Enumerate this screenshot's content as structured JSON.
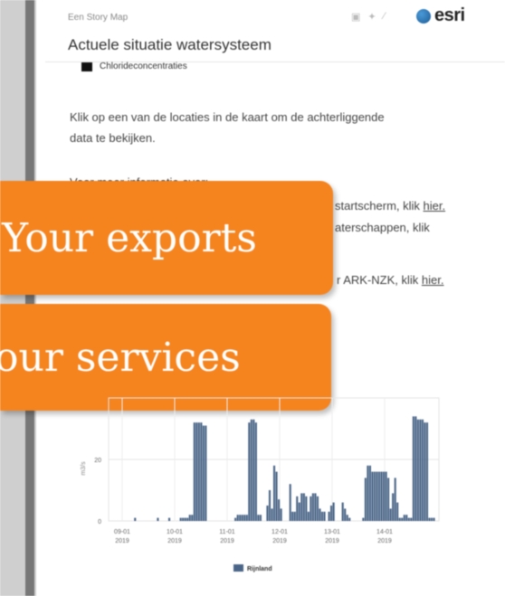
{
  "header": {
    "story_label": "Een Story Map",
    "title": "Actuele situatie watersysteem",
    "share_icons": [
      "facebook-icon",
      "twitter-icon",
      "link-icon"
    ],
    "logo_text": "esri"
  },
  "legend_top": {
    "label": "Chlorideconcentraties",
    "color": "#111111"
  },
  "content": {
    "intro_line1": "Klik op een van de locaties in de kaart om de achterliggende",
    "intro_line2": "data te bekijken.",
    "more_info": "Voor meer informatie over:",
    "line_a_text": "startscherm, klik ",
    "line_a_link": "hier.",
    "line_b_text": "aterschappen, klik",
    "line_c_text": "r ARK-NZK, klik ",
    "line_c_link": "hier."
  },
  "overlays": {
    "exports_label": "Your exports",
    "services_label": "our services",
    "color": "#f5841f"
  },
  "chart_data": {
    "type": "bar",
    "ylabel": "m3/s",
    "ylim": [
      0,
      40
    ],
    "yticks": [
      0,
      20
    ],
    "xtick_labels": [
      [
        "09-01",
        "2019"
      ],
      [
        "10-01",
        "2019"
      ],
      [
        "11-01",
        "2019"
      ],
      [
        "12-01",
        "2019"
      ],
      [
        "13-01",
        "2019"
      ],
      [
        "14-01",
        "2019"
      ]
    ],
    "legend": "Rijnland",
    "bar_color": "#4a6587",
    "values": [
      0,
      0,
      0,
      0,
      0,
      0,
      0,
      0,
      1,
      0,
      0,
      0,
      0,
      0,
      0,
      0,
      0,
      0,
      1,
      0,
      0,
      0,
      0,
      1,
      0,
      0,
      0,
      0,
      1,
      1,
      1,
      1,
      2,
      2,
      32,
      32,
      32,
      32,
      31,
      31,
      0,
      0,
      0,
      0,
      0,
      0,
      0,
      0,
      0,
      0,
      0,
      0,
      1,
      2,
      2,
      2,
      2,
      2,
      32,
      33,
      33,
      32,
      2,
      2,
      0,
      0,
      5,
      10,
      4,
      18,
      16,
      7,
      4,
      0,
      0,
      0,
      12,
      3,
      3,
      8,
      6,
      9,
      9,
      8,
      3,
      8,
      9,
      9,
      8,
      4,
      3,
      3,
      0,
      3,
      5,
      6,
      0,
      0,
      0,
      6,
      4,
      2,
      1,
      0,
      0,
      0,
      0,
      0,
      1,
      14,
      18,
      18,
      16,
      16,
      16,
      16,
      16,
      16,
      16,
      14,
      4,
      9,
      14,
      6,
      1,
      1,
      2,
      2,
      1,
      1,
      34,
      34,
      33,
      33,
      33,
      32,
      32,
      1,
      1,
      1
    ]
  }
}
